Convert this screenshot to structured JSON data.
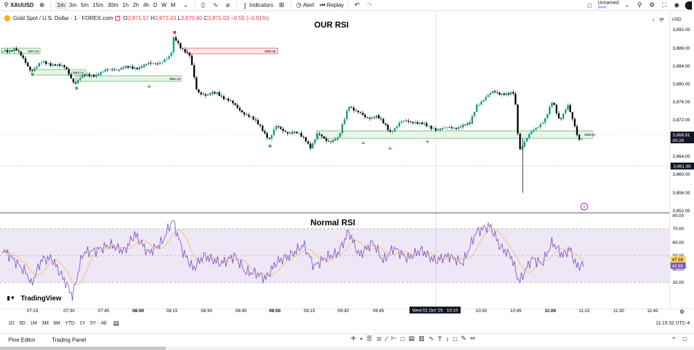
{
  "toolbar": {
    "symbol": "XAUUSD",
    "timeframes": [
      "1m",
      "3m",
      "5m",
      "15m",
      "30m",
      "1h",
      "2h",
      "4h",
      "D",
      "W",
      "M"
    ],
    "active_timeframe": "1m",
    "indicators_label": "Indicators",
    "alert_label": "Alert",
    "replay_label": "Replay",
    "layout_name": "Unnamed",
    "layout_status": "Save"
  },
  "legend": {
    "title": "Gold Spot / U.S. Dollar · 1 · FOREX.com",
    "o_label": "O",
    "o": "3,871.57",
    "h_label": "H",
    "h": "3,872.43",
    "l_label": "L",
    "l": "3,870.60",
    "c_label": "C",
    "c": "3,871.03",
    "change": "−0.55 (−0.01%)"
  },
  "price_pane": {
    "title": "OUR RSI",
    "currency": "USD",
    "ticks": [
      "3,892.00",
      "3,888.00",
      "3,884.00",
      "3,880.00",
      "3,876.00",
      "3,872.00",
      "3,868.00",
      "3,864.00",
      "3,860.00",
      "3,856.00",
      "3,852.00"
    ],
    "last_price": "3,868.81",
    "countdown": "00:29",
    "crosshair_price": "3,861.90",
    "zone_labels": [
      "3887.81",
      "3883.22",
      "3881.81",
      "3886.56",
      "3868.81"
    ]
  },
  "rsi_pane": {
    "title": "Normal RSI",
    "ticks": [
      "80.00",
      "70.00",
      "60.00",
      "50.00",
      "40.00",
      "30.00"
    ],
    "rsi_value": "42.65",
    "ma_value": "47.58"
  },
  "time_axis": {
    "ticks": [
      "07:15",
      "07:30",
      "07:45",
      "08:00",
      "08:15",
      "08:30",
      "08:45",
      "09:00",
      "09:15",
      "09:30",
      "09:45",
      "10:00",
      "10:15",
      "10:30",
      "10:45",
      "11:00",
      "11:15",
      "11:30",
      "11:45"
    ],
    "crosshair_label": "Wed 01 Oct '25   10:10"
  },
  "watermark": "TradingView",
  "ranges": [
    "1D",
    "5D",
    "1M",
    "3M",
    "6M",
    "YTD",
    "1Y",
    "5Y",
    "All"
  ],
  "clock": "11:15:32 UTC-4",
  "footer": {
    "tab1": "Pine Editor",
    "tab2": "Trading Panel"
  },
  "colors": {
    "up": "#089981",
    "down": "#000000",
    "zone_green": "#4caf50",
    "zone_red": "#f23645",
    "rsi": "#7e57c2",
    "rsi_ma": "#ffb74d",
    "rsi_band": "#ede7f6"
  },
  "chart_data": [
    {
      "type": "candlestick",
      "title": "OUR RSI",
      "ylim": [
        3852,
        3894
      ],
      "x": [
        "07:15",
        "07:30",
        "07:45",
        "08:00",
        "08:15",
        "08:30",
        "08:45",
        "09:00",
        "09:15",
        "09:30",
        "09:45",
        "10:00",
        "10:15",
        "10:30",
        "10:45",
        "11:00",
        "11:15"
      ],
      "close": [
        3887.8,
        3885.5,
        3880.5,
        3885.0,
        3887.5,
        3877.0,
        3874.0,
        3867.0,
        3866.0,
        3874.0,
        3871.0,
        3871.5,
        3875.0,
        3878.0,
        3866.0,
        3871.5,
        3868.8
      ]
    },
    {
      "type": "line",
      "title": "Normal RSI",
      "ylim": [
        20,
        80
      ],
      "series": [
        {
          "values": [
            55,
            36,
            29,
            48,
            52,
            54,
            70,
            46,
            37,
            35,
            45,
            55,
            42,
            53,
            69,
            54,
            44,
            62,
            44,
            52,
            60,
            45,
            59,
            55,
            63,
            42,
            37,
            60,
            54,
            43
          ]
        }
      ]
    }
  ]
}
